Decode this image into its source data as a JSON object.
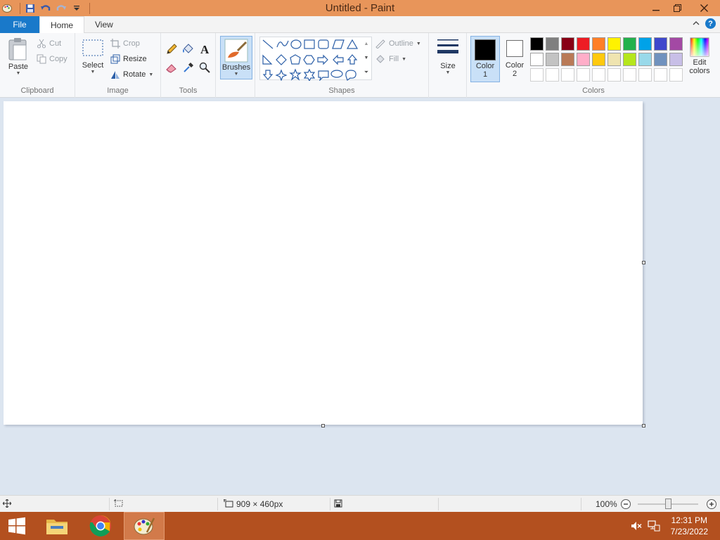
{
  "window": {
    "title": "Untitled - Paint"
  },
  "tabs": {
    "file": "File",
    "home": "Home",
    "view": "View"
  },
  "ribbon": {
    "clipboard": {
      "label": "Clipboard",
      "paste": "Paste",
      "cut": "Cut",
      "copy": "Copy"
    },
    "image": {
      "label": "Image",
      "select": "Select",
      "crop": "Crop",
      "resize": "Resize",
      "rotate": "Rotate"
    },
    "tools": {
      "label": "Tools"
    },
    "brushes": {
      "label": "Brushes"
    },
    "shapes": {
      "label": "Shapes",
      "outline": "Outline",
      "fill": "Fill"
    },
    "size": {
      "label": "Size"
    },
    "colors": {
      "label": "Colors",
      "color1": "Color",
      "color1_num": "1",
      "color2": "Color",
      "color2_num": "2",
      "edit": "Edit",
      "edit2": "colors",
      "palette_row1": [
        "#000000",
        "#7f7f7f",
        "#880015",
        "#ed1c24",
        "#ff7f27",
        "#fff200",
        "#22b14c",
        "#00a2e8",
        "#3f48cc",
        "#a349a4"
      ],
      "palette_row2": [
        "#ffffff",
        "#c3c3c3",
        "#b97a57",
        "#ffaec9",
        "#ffc90e",
        "#efe4b0",
        "#b5e61d",
        "#99d9ea",
        "#7092be",
        "#c8bfe7"
      ],
      "color1_value": "#000000",
      "color2_value": "#ffffff"
    }
  },
  "statusbar": {
    "dimensions": "909 × 460px",
    "zoom": "100%"
  },
  "taskbar": {
    "time": "12:31 PM",
    "date": "7/23/2022"
  }
}
